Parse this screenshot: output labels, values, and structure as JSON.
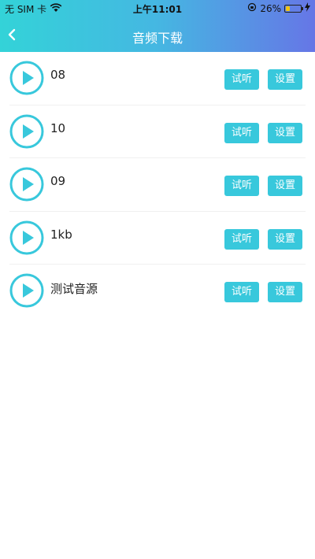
{
  "status_bar": {
    "carrier": "无 SIM 卡",
    "time": "上午11:01",
    "battery": "26%",
    "battery_level": 0.26
  },
  "navbar": {
    "title": "音频下载",
    "back_icon": "chevron-left-icon"
  },
  "audio_list": [
    {
      "name": "08",
      "try_label": "试听",
      "settings_label": "设置"
    },
    {
      "name": "10",
      "try_label": "试听",
      "settings_label": "设置"
    },
    {
      "name": "09",
      "try_label": "试听",
      "settings_label": "设置"
    },
    {
      "name": "1kb",
      "try_label": "试听",
      "settings_label": "设置"
    },
    {
      "name": "测试音源",
      "try_label": "试听",
      "settings_label": "设置"
    }
  ],
  "colors": {
    "header_gradient_start": "#33d3d8",
    "header_gradient_end": "#6676e6",
    "accent": "#38c8dc"
  }
}
